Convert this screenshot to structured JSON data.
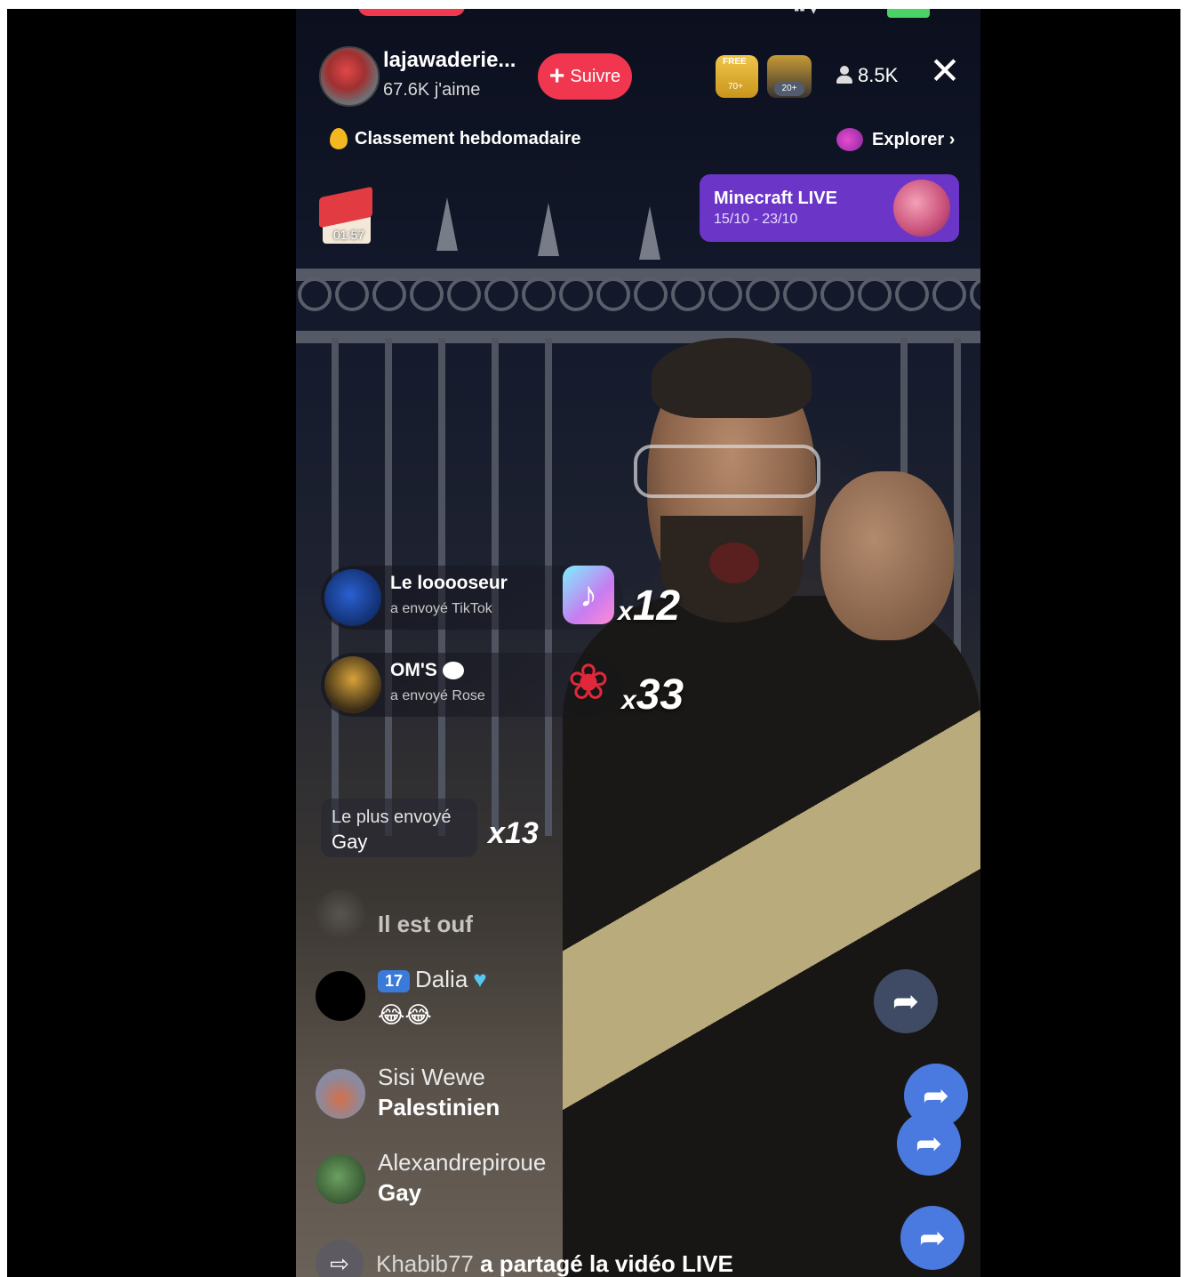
{
  "host": {
    "name": "lajawaderie...",
    "likes": "67.6K j'aime",
    "follow_label": "Suivre",
    "follow_icon": "+"
  },
  "badges": [
    {
      "label": "FREE",
      "count": "70+"
    },
    {
      "label": "",
      "count": "20+"
    }
  ],
  "viewers": "8.5K",
  "close_icon": "✕",
  "ranking": "Classement hebdomadaire",
  "explore": "Explorer ›",
  "promo": {
    "title": "Minecraft LIVE",
    "dates": "15/10 - 23/10"
  },
  "gift_timer": "01:57",
  "gifts": [
    {
      "user": "Le looooseur",
      "sent": "a envoyé  TikTok",
      "icon": "tiktok-icon",
      "multiplier_x": "x",
      "multiplier": "12"
    },
    {
      "user": "OM'S",
      "sent": "a envoyé  Rose",
      "icon": "rose-icon",
      "multiplier_x": "x",
      "multiplier": "33"
    }
  ],
  "most_sent": {
    "label": "Le plus envoyé",
    "value": "Gay",
    "multiplier": "x13"
  },
  "comments": [
    {
      "user": "",
      "text": "Il est ouf"
    },
    {
      "level": "17",
      "user": "Dalia",
      "text": "😂😂"
    },
    {
      "user": "Sisi Wewe",
      "text": "Palestinien"
    },
    {
      "user": "Alexandrepiroue",
      "text": "Gay"
    }
  ],
  "share": {
    "user": "Khabib77",
    "text": "a partagé la vidéo LIVE"
  },
  "colors": {
    "accent": "#f0374f",
    "promo": "#6b36c8",
    "fab": "#4a7ae0"
  }
}
